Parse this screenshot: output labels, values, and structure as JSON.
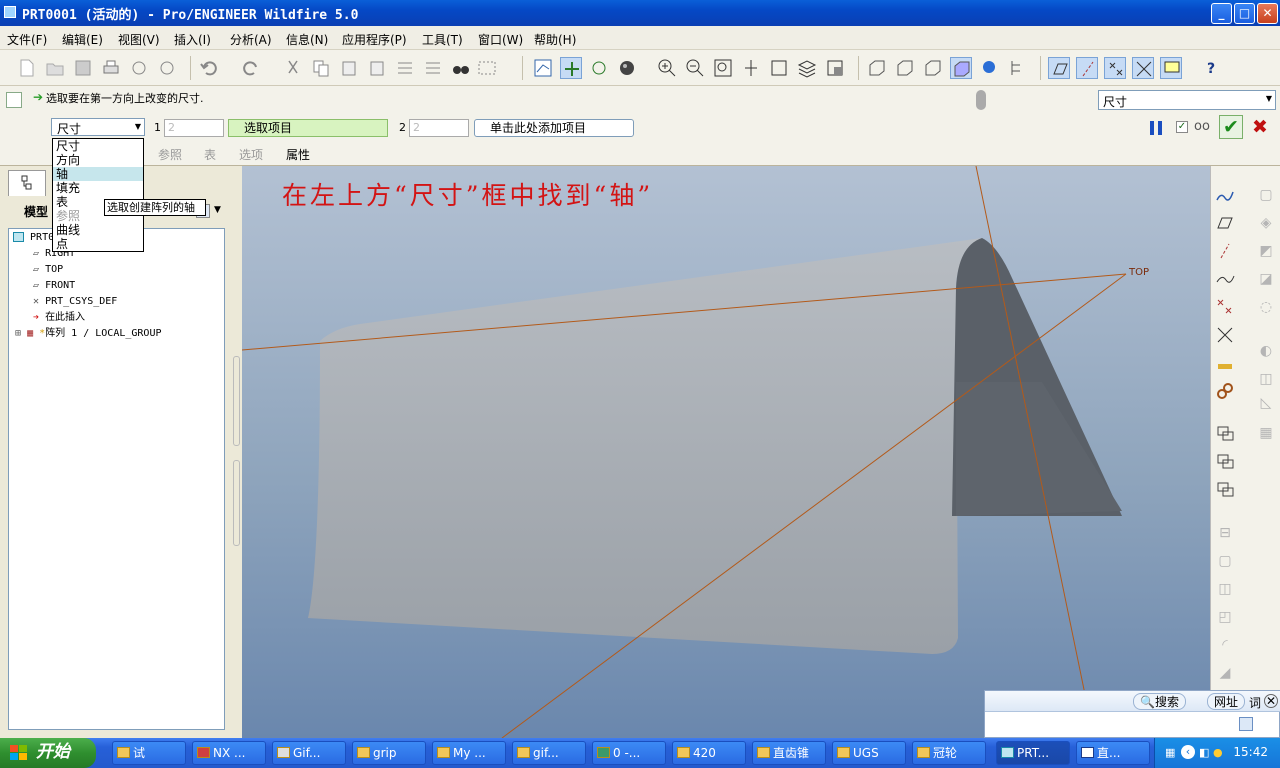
{
  "window": {
    "title": "PRT0001 (活动的) - Pro/ENGINEER Wildfire 5.0",
    "min": "_",
    "max": "□",
    "close": "✕"
  },
  "menu": [
    "文件(F)",
    "编辑(E)",
    "视图(V)",
    "插入(I)",
    "分析(A)",
    "信息(N)",
    "应用程序(P)",
    "工具(T)",
    "窗口(W)",
    "帮助(H)"
  ],
  "dashboard": {
    "message": "选取要在第一方向上改变的尺寸.",
    "right_select": "尺寸",
    "type_select": "尺寸",
    "dir1_label": "1",
    "dir1_value": "2",
    "select_items": "选取项目",
    "dir2_label": "2",
    "dir2_value": "2",
    "add_item": "单击此处添加项目",
    "subtabs": [
      "尺寸",
      "参照",
      "表",
      "选项",
      "属性"
    ],
    "ok": "✔",
    "cancel": "✖"
  },
  "dropdown": {
    "options": [
      "尺寸",
      "方向",
      "轴",
      "填充",
      "表",
      "参照",
      "曲线",
      "点"
    ],
    "selected": "轴",
    "disabled": [
      "参照"
    ],
    "tooltip": "选取创建阵列的轴"
  },
  "model_tree": {
    "tab": "模型",
    "items": [
      {
        "label": "PRT0001.PRT",
        "icon": "part-icon"
      },
      {
        "label": "RIGHT",
        "icon": "datum-plane-icon"
      },
      {
        "label": "TOP",
        "icon": "datum-plane-icon"
      },
      {
        "label": "FRONT",
        "icon": "datum-plane-icon"
      },
      {
        "label": "PRT_CSYS_DEF",
        "icon": "csys-icon"
      },
      {
        "label": "在此插入",
        "icon": "insert-arrow-icon"
      },
      {
        "label": "阵列 1 / LOCAL_GROUP",
        "icon": "pattern-icon"
      }
    ]
  },
  "viewport": {
    "annotation": "在左上方“尺寸”框中找到“轴”",
    "datum_label": "TOP",
    "colors": {
      "annotation": "#d31414",
      "datum": "#b35a1a",
      "surface": "#a3a9b0"
    }
  },
  "search": {
    "search_label": "搜索",
    "url_label": "网址",
    "word_label": "词"
  },
  "taskbar": {
    "start": "开始",
    "tasks": [
      "试",
      "NX ...",
      "Gif...",
      "grip",
      "My ...",
      "gif...",
      "0 -...",
      "420",
      "直齿锥",
      "UGS",
      "冠轮",
      "PRT...",
      "直..."
    ],
    "clock": "15:42"
  }
}
